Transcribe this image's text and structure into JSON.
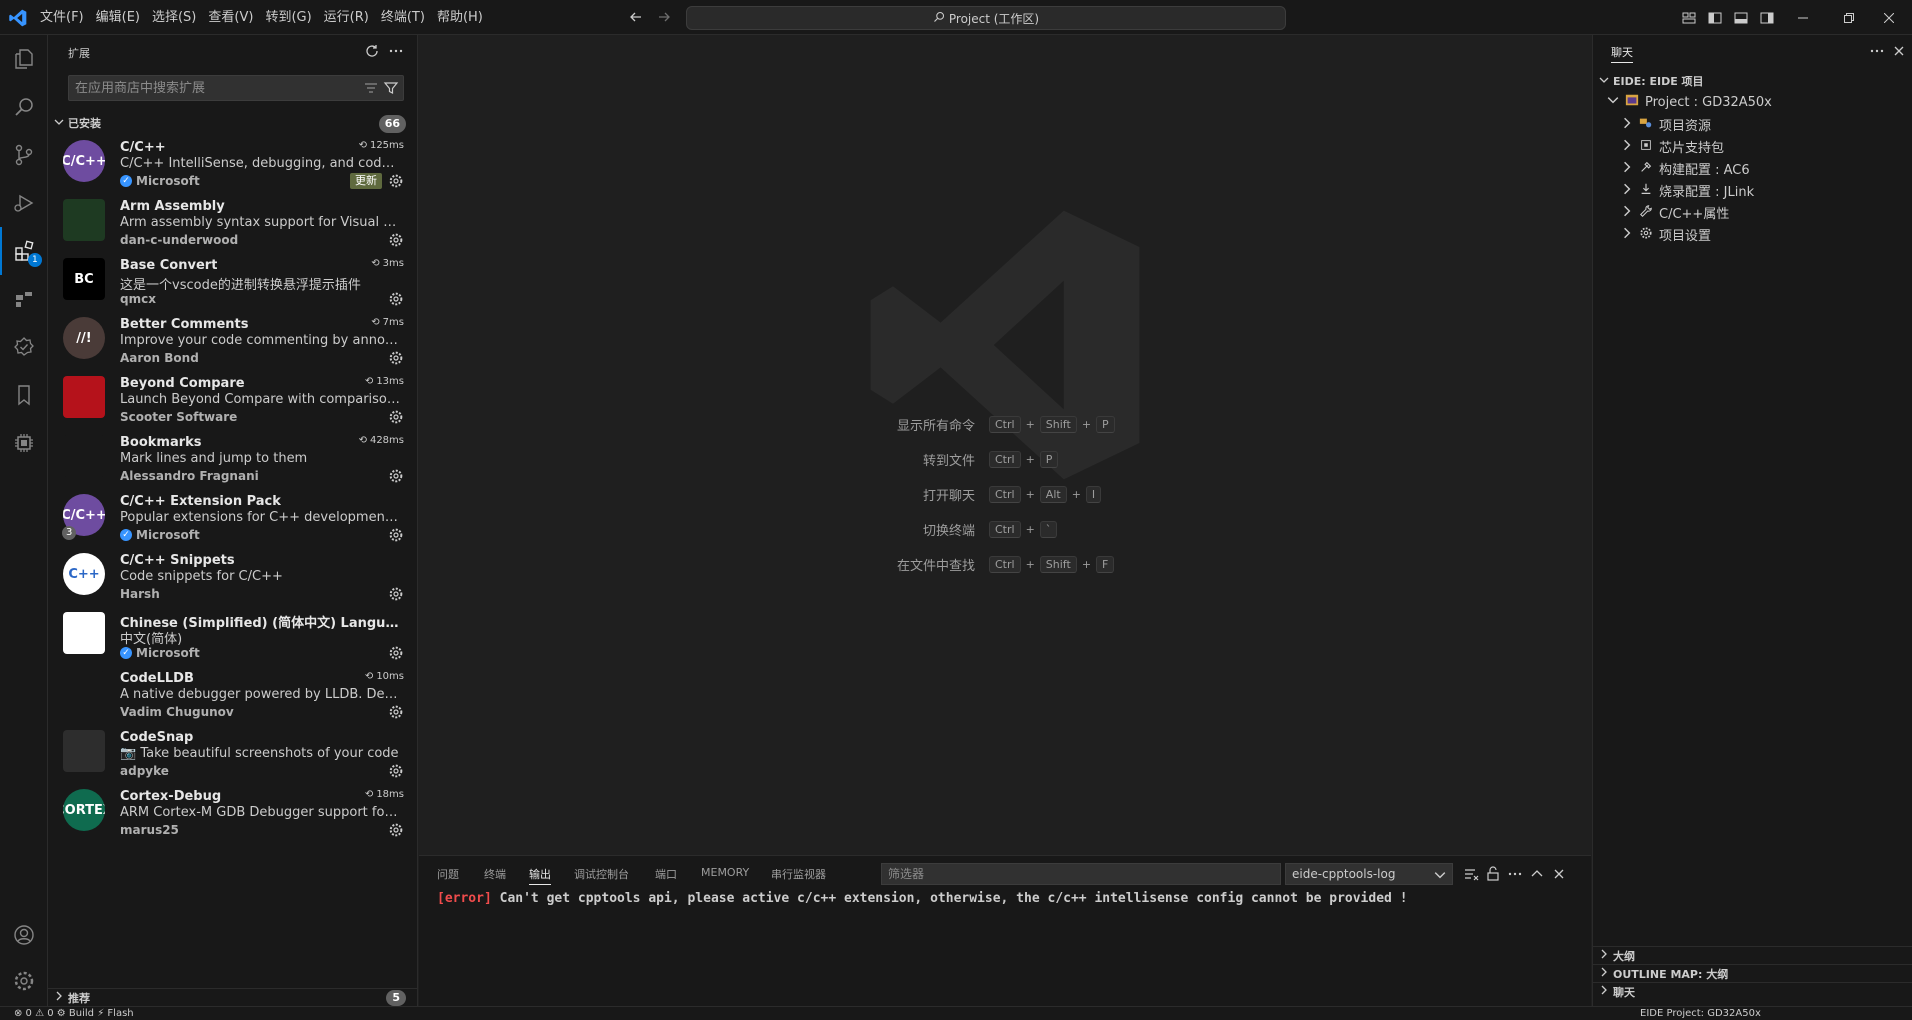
{
  "menu": [
    "文件(F)",
    "编辑(E)",
    "选择(S)",
    "查看(V)",
    "转到(G)",
    "运行(R)",
    "终端(T)",
    "帮助(H)"
  ],
  "command_center": "Project (工作区)",
  "sidebar": {
    "title": "扩展",
    "search_placeholder": "在应用商店中搜索扩展",
    "installed_label": "已安装",
    "installed_count": "66",
    "recommended_label": "推荐",
    "recommended_count": "5",
    "update_label": "更新",
    "extensions": [
      {
        "name": "C/C++",
        "desc": "C/C++ IntelliSense, debugging, and code brows...",
        "publisher": "Microsoft",
        "verified": true,
        "time": "125ms",
        "icon_text": "C/C++",
        "icon_color": "#6e4ca0",
        "update": true
      },
      {
        "name": "Arm Assembly",
        "desc": "Arm assembly syntax support for Visual Studio ...",
        "publisher": "dan-c-underwood",
        "verified": false,
        "time": "",
        "icon_text": "",
        "icon_color": "#1e3a22"
      },
      {
        "name": "Base Convert",
        "desc": "这是一个vscode的进制转换悬浮提示插件",
        "publisher": "qmcx",
        "verified": false,
        "time": "3ms",
        "icon_text": "BC",
        "icon_color": "#000000"
      },
      {
        "name": "Better Comments",
        "desc": "Improve your code commenting by annotating ...",
        "publisher": "Aaron Bond",
        "verified": false,
        "time": "7ms",
        "icon_text": "//!",
        "icon_color": "#4a3b38"
      },
      {
        "name": "Beyond Compare",
        "desc": "Launch Beyond Compare with comparisons of fi...",
        "publisher": "Scooter Software",
        "verified": false,
        "time": "13ms",
        "icon_text": "",
        "icon_color": "#b5121b"
      },
      {
        "name": "Bookmarks",
        "desc": "Mark lines and jump to them",
        "publisher": "Alessandro Fragnani",
        "verified": false,
        "time": "428ms",
        "icon_text": "",
        "icon_color": "#181818"
      },
      {
        "name": "C/C++ Extension Pack",
        "desc": "Popular extensions for C++ development in Vis...",
        "publisher": "Microsoft",
        "verified": true,
        "time": "",
        "icon_text": "C/C++",
        "icon_color": "#6e4ca0",
        "pack_count": "3"
      },
      {
        "name": "C/C++ Snippets",
        "desc": "Code snippets for C/C++",
        "publisher": "Harsh",
        "verified": false,
        "time": "",
        "icon_text": "C++",
        "icon_color": "#ffffff"
      },
      {
        "name": "Chinese (Simplified) (简体中文) Language Pa...",
        "desc": "中文(简体)",
        "publisher": "Microsoft",
        "verified": true,
        "time": "",
        "icon_text": "",
        "icon_color": "#ffffff"
      },
      {
        "name": "CodeLLDB",
        "desc": "A native debugger powered by LLDB. Debug C+...",
        "publisher": "Vadim Chugunov",
        "verified": false,
        "time": "10ms",
        "icon_text": "",
        "icon_color": "#181818"
      },
      {
        "name": "CodeSnap",
        "desc": "📷 Take beautiful screenshots of your code",
        "publisher": "adpyke",
        "verified": false,
        "time": "",
        "icon_text": "",
        "icon_color": "#2d2d2d"
      },
      {
        "name": "Cortex-Debug",
        "desc": "ARM Cortex-M GDB Debugger support for VSC...",
        "publisher": "marus25",
        "verified": false,
        "time": "18ms",
        "icon_text": "CORTEX",
        "icon_color": "#0f6b4f"
      }
    ]
  },
  "editor": {
    "shortcuts": [
      {
        "label": "显示所有命令",
        "keys": [
          "Ctrl",
          "Shift",
          "P"
        ]
      },
      {
        "label": "转到文件",
        "keys": [
          "Ctrl",
          "P"
        ]
      },
      {
        "label": "打开聊天",
        "keys": [
          "Ctrl",
          "Alt",
          "I"
        ]
      },
      {
        "label": "切换终端",
        "keys": [
          "Ctrl",
          "`"
        ]
      },
      {
        "label": "在文件中查找",
        "keys": [
          "Ctrl",
          "Shift",
          "F"
        ]
      }
    ]
  },
  "panel": {
    "tabs": [
      "问题",
      "终端",
      "输出",
      "调试控制台",
      "端口",
      "MEMORY",
      "串行监视器"
    ],
    "active_tab": "输出",
    "filter_placeholder": "筛选器",
    "output_channel": "eide-cpptools-log",
    "log_prefix": "[error]",
    "log_text": " Can't get cpptools api, please active c/c++ extension, otherwise, the c/c++ intellisense config cannot be provided !"
  },
  "rightpane": {
    "title": "聊天",
    "section": "EIDE: EIDE 项目",
    "project": "Project : GD32A50x",
    "items": [
      "项目资源",
      "芯片支持包",
      "构建配置 : AC6",
      "烧录配置 : JLink",
      "C/C++属性",
      "项目设置"
    ],
    "bottom_sections": [
      "大纲",
      "OUTLINE MAP: 大纲",
      "聊天"
    ]
  },
  "activity_badge": "1",
  "status": {
    "left": "⊗ 0 ⚠ 0   ⚙ Build   ⚡ Flash",
    "right": "EIDE Project: GD32A50x"
  },
  "colors": {
    "accent": "#0078d4",
    "error": "#f14c4c",
    "bg": "#1f1f1f",
    "sidebar": "#181818"
  }
}
